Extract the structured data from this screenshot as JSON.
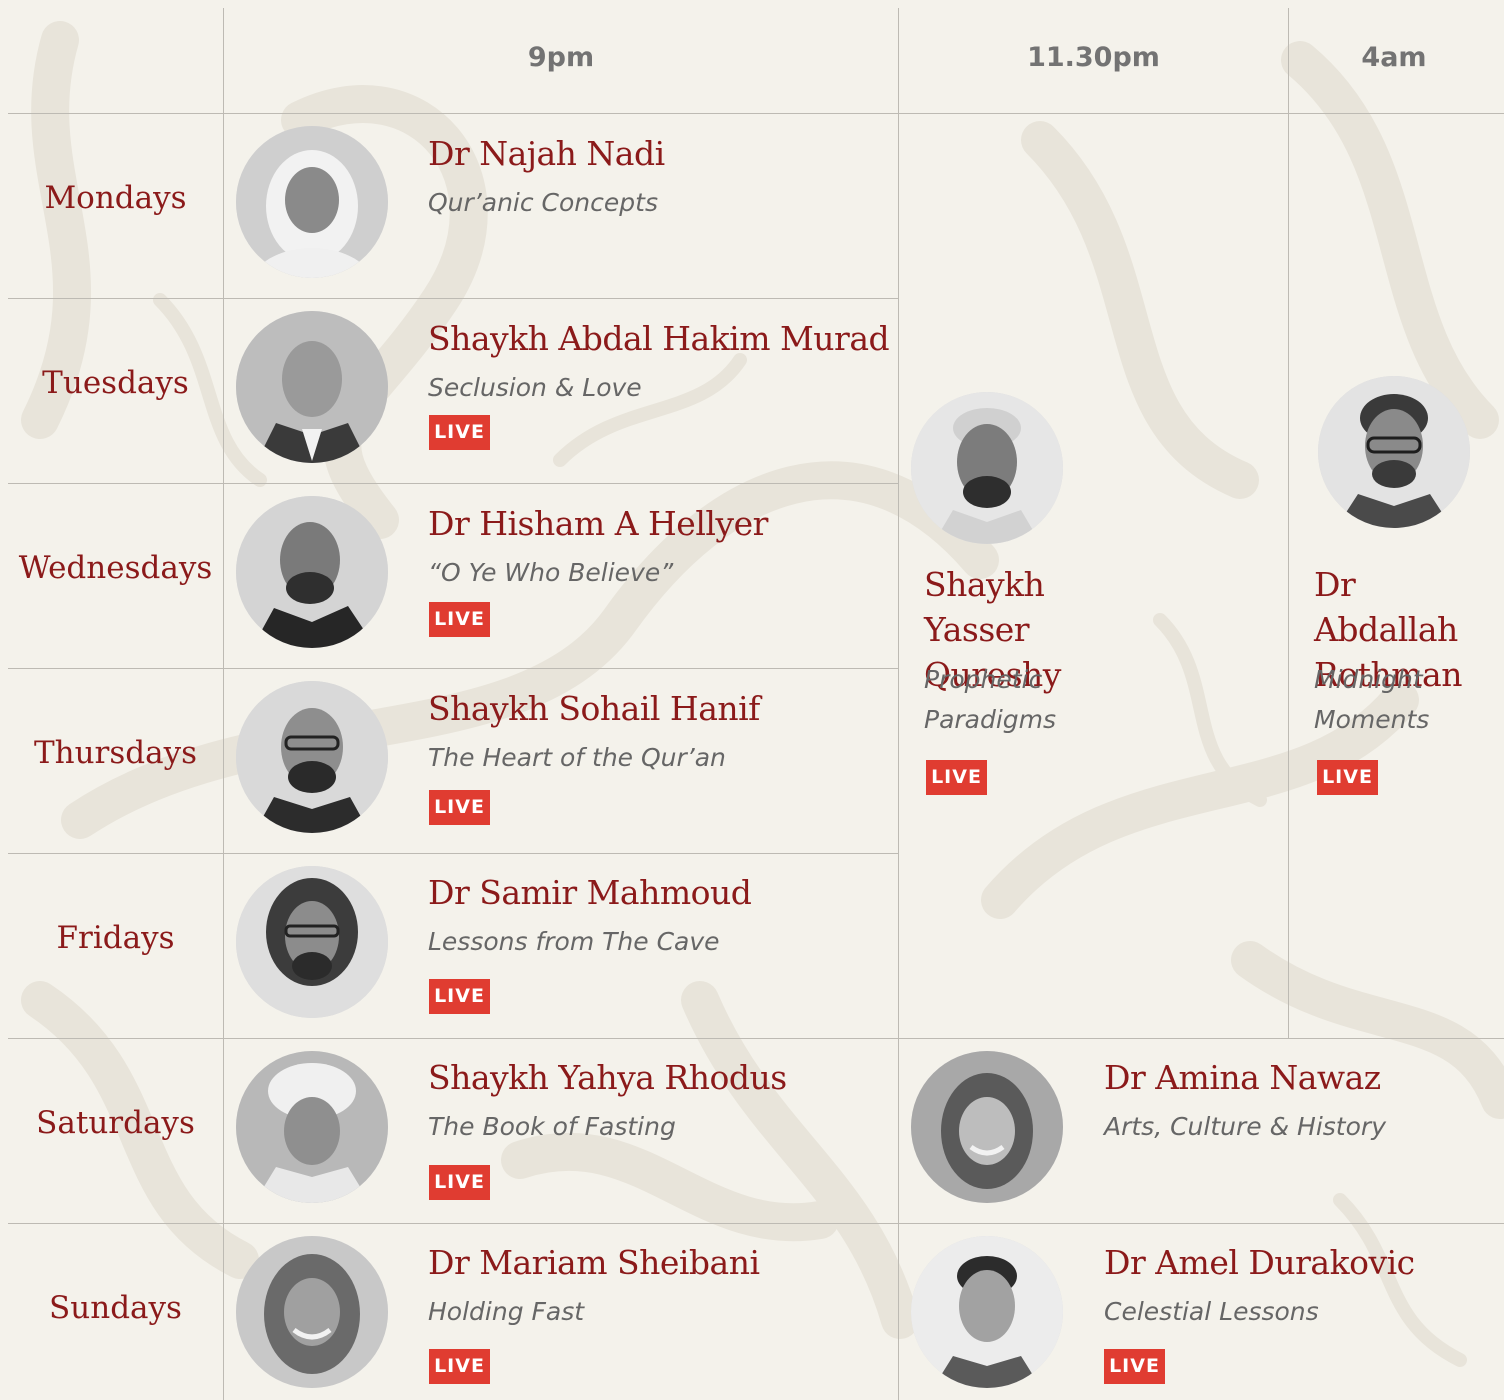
{
  "times": [
    "9pm",
    "11.30pm",
    "4am"
  ],
  "days": [
    "Mondays",
    "Tuesdays",
    "Wednesdays",
    "Thursdays",
    "Fridays",
    "Saturdays",
    "Sundays"
  ],
  "live_label": "LIVE",
  "nine_pm": [
    {
      "name": "Dr Najah Nadi",
      "course": "Qur’anic Concepts",
      "live": false
    },
    {
      "name": "Shaykh Abdal Hakim Murad",
      "course": "Seclusion & Love",
      "live": true
    },
    {
      "name": "Dr Hisham A Hellyer",
      "course": "“O Ye Who Believe”",
      "live": true
    },
    {
      "name": "Shaykh Sohail Hanif",
      "course": "The Heart of the Qur’an",
      "live": true
    },
    {
      "name": "Dr Samir Mahmoud",
      "course": "Lessons from The Cave",
      "live": true
    },
    {
      "name": "Shaykh Yahya Rhodus",
      "course": "The Book of Fasting",
      "live": true
    },
    {
      "name": "Dr Mariam Sheibani",
      "course": "Holding Fast",
      "live": true
    }
  ],
  "weekday_late": {
    "name": "Shaykh Yasser Qureshy",
    "course": "Prophetic Paradigms",
    "live": true
  },
  "weekday_4am": {
    "name": "Dr Abdallah Rothman",
    "course": "Midnight Moments",
    "live": true
  },
  "saturday_late": {
    "name": "Dr Amina Nawaz",
    "course": "Arts, Culture & History",
    "live": false
  },
  "sunday_late": {
    "name": "Dr Amel Durakovic",
    "course": "Celestial Lessons",
    "live": true
  },
  "colors": {
    "background": "#f4f2eb",
    "name": "#8b1a1a",
    "live_badge": "#e03c31",
    "course": "#666666",
    "header": "#737373"
  }
}
